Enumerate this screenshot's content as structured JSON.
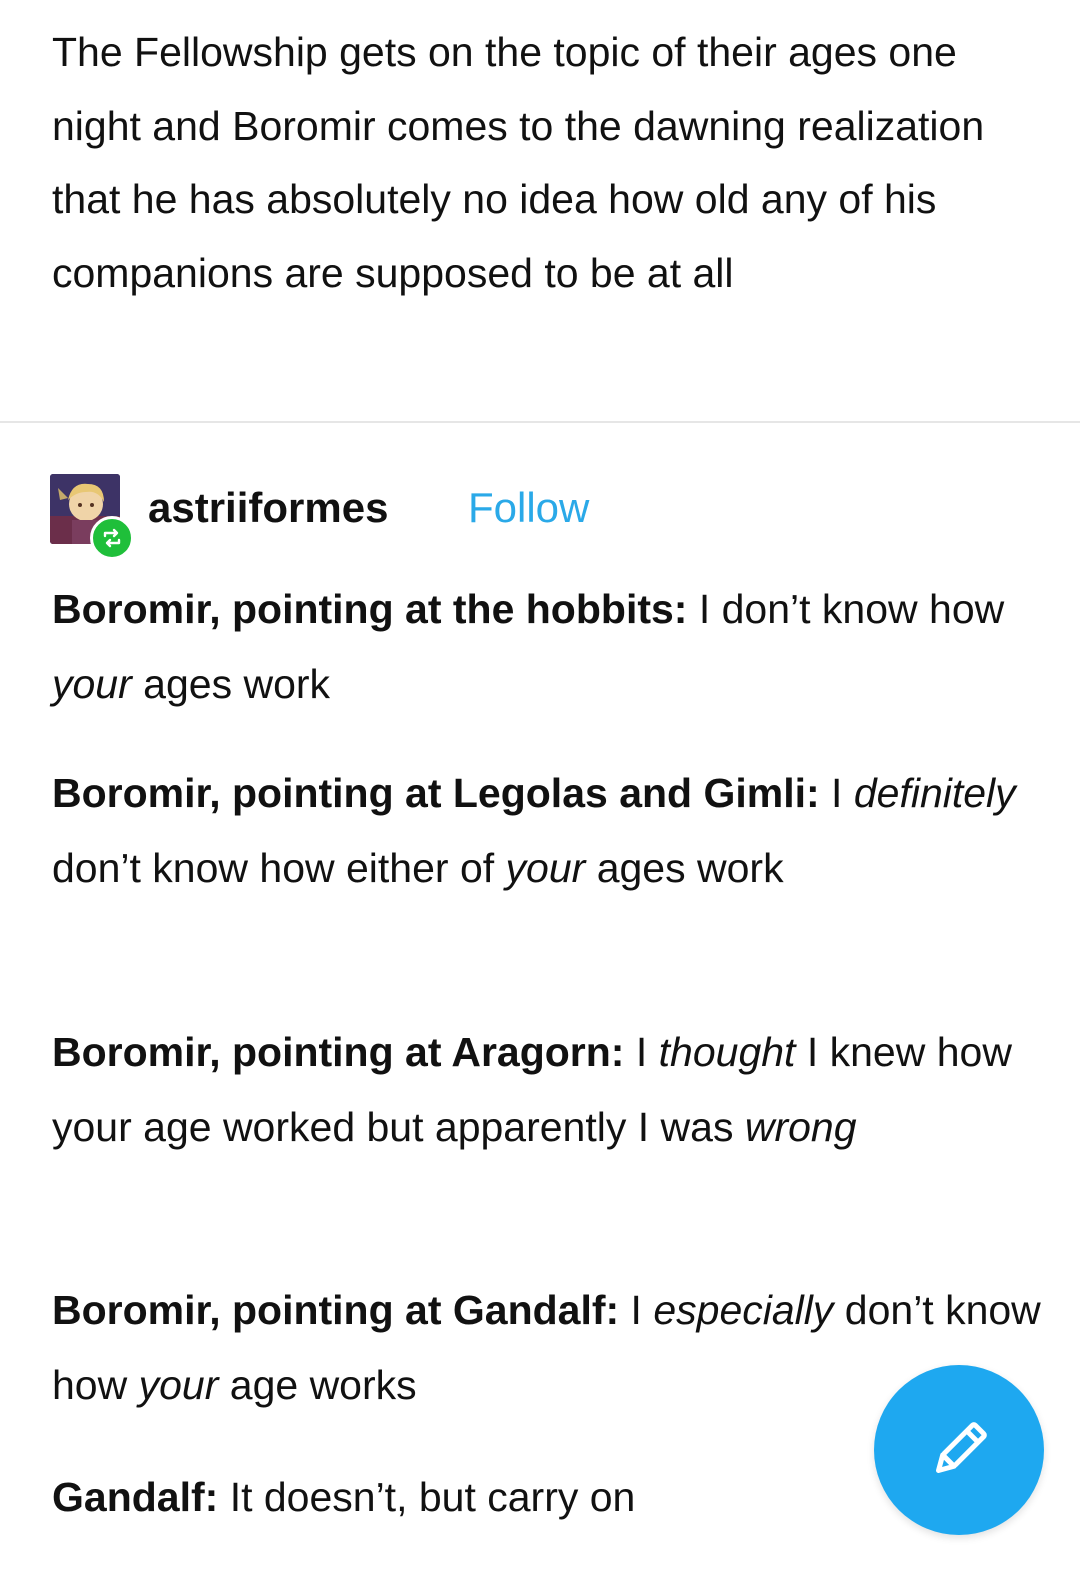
{
  "post": {
    "text": "The Fellowship gets on the topic of their ages one night and Boromir comes to the dawning realization that he has absolutely no idea how old any of his companions are supposed to be at all"
  },
  "reblog": {
    "username": "astriiformes",
    "follow_label": "Follow",
    "avatar_icon": "avatar-image",
    "badge_icon": "reblog-icon",
    "badge_color": "#1fbf3a",
    "follow_color": "#2aa9e8"
  },
  "dialogue": [
    {
      "speaker": "Boromir, pointing at the hobbits:",
      "parts": [
        {
          "text": " I don’t know how ",
          "italic": false
        },
        {
          "text": "your",
          "italic": true
        },
        {
          "text": " ages work",
          "italic": false
        }
      ]
    },
    {
      "speaker": "Boromir, pointing at Legolas and Gimli:",
      "parts": [
        {
          "text": " I ",
          "italic": false
        },
        {
          "text": "definitely",
          "italic": true
        },
        {
          "text": " don’t know how either of ",
          "italic": false
        },
        {
          "text": "your",
          "italic": true
        },
        {
          "text": " ages work",
          "italic": false
        }
      ]
    },
    {
      "speaker": "Boromir, pointing at Aragorn:",
      "parts": [
        {
          "text": " I ",
          "italic": false
        },
        {
          "text": "thought",
          "italic": true
        },
        {
          "text": " I knew how your age worked but apparently I was ",
          "italic": false
        },
        {
          "text": "wrong",
          "italic": true
        }
      ]
    },
    {
      "speaker": "Boromir, pointing at Gandalf:",
      "parts": [
        {
          "text": " I ",
          "italic": false
        },
        {
          "text": "especially",
          "italic": true
        },
        {
          "text": " don’t know how ",
          "italic": false
        },
        {
          "text": "your",
          "italic": true
        },
        {
          "text": " age works",
          "italic": false
        }
      ]
    },
    {
      "speaker": "Gandalf:",
      "parts": [
        {
          "text": " It doesn’t, but carry on",
          "italic": false
        }
      ]
    }
  ],
  "fab": {
    "icon": "pencil-icon",
    "color": "#1ea8f0"
  }
}
